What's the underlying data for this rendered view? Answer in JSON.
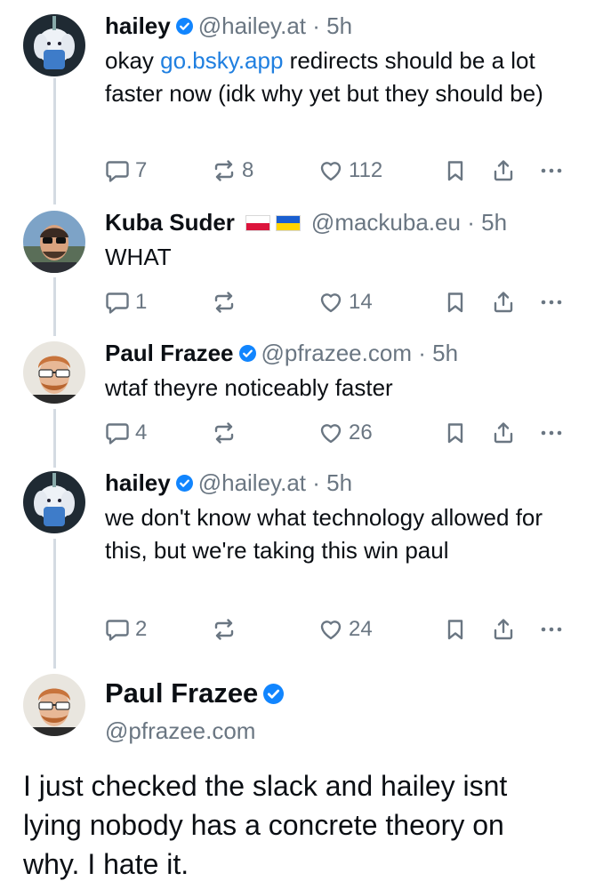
{
  "posts": [
    {
      "name": "hailey",
      "verified": true,
      "flags": [],
      "handle": "@hailey.at",
      "time": "5h",
      "text_before": "okay ",
      "link": "go.bsky.app",
      "text_after": " redirects should be a lot faster now (idk why yet but they should be)",
      "replies": "7",
      "reposts": "8",
      "likes": "112"
    },
    {
      "name": "Kuba Suder",
      "verified": false,
      "flags": [
        "poland-flag",
        "ukraine-flag"
      ],
      "handle": "@mackuba.eu",
      "time": "5h",
      "text": "WHAT",
      "replies": "1",
      "reposts": "",
      "likes": "14"
    },
    {
      "name": "Paul Frazee",
      "verified": true,
      "flags": [],
      "handle": "@pfrazee.com",
      "time": "5h",
      "text": "wtaf theyre noticeably faster",
      "replies": "4",
      "reposts": "",
      "likes": "26"
    },
    {
      "name": "hailey",
      "verified": true,
      "flags": [],
      "handle": "@hailey.at",
      "time": "5h",
      "text": "we don't know what technology allowed for this, but we're taking this win paul",
      "replies": "2",
      "reposts": "",
      "likes": "24"
    }
  ],
  "main_post": {
    "name": "Paul Frazee",
    "verified": true,
    "handle": "@pfrazee.com",
    "text": "I just checked the slack and hailey isnt lying nobody has a concrete theory on why. I hate it."
  },
  "separator": "·",
  "colors": {
    "accent": "#1f7fe0",
    "muted": "#6a7682",
    "thread_line": "#d4dbe2",
    "verified": "#1185fe"
  },
  "icons": [
    "reply-icon",
    "repost-icon",
    "like-icon",
    "bookmark-icon",
    "share-icon",
    "more-icon",
    "verified-icon"
  ]
}
